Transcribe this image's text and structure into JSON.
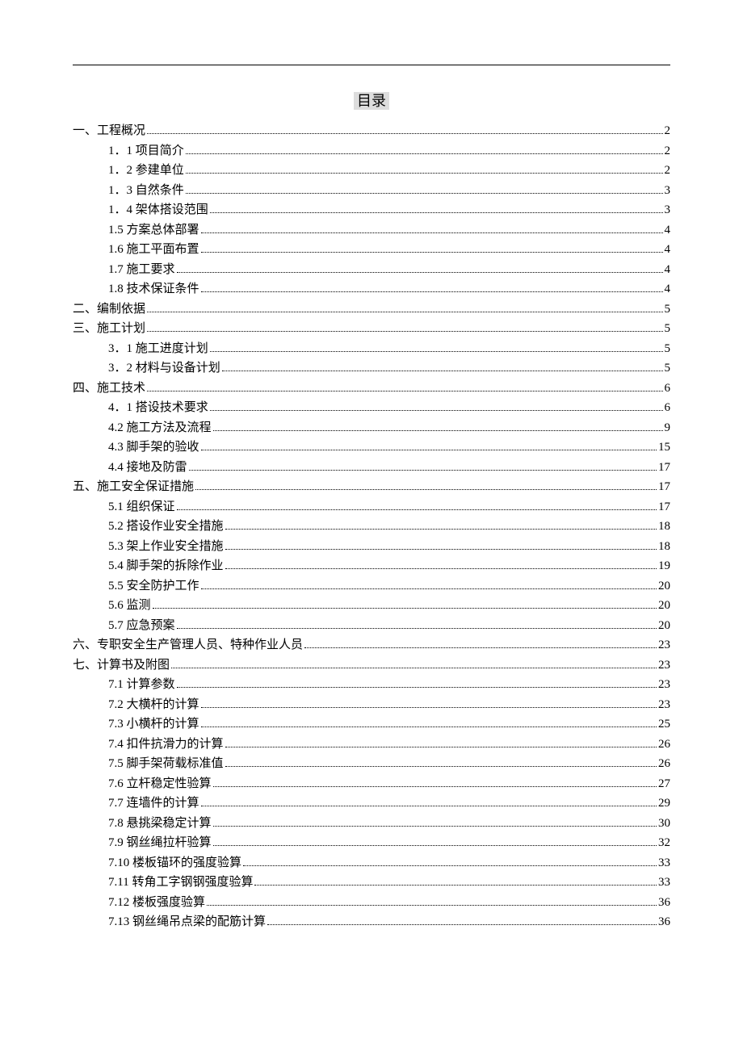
{
  "title": "目录",
  "entries": [
    {
      "level": 1,
      "label": "一、工程概况",
      "page": "2"
    },
    {
      "level": 2,
      "label": "1．1 项目简介",
      "page": "2"
    },
    {
      "level": 2,
      "label": "1．2 参建单位",
      "page": "2"
    },
    {
      "level": 2,
      "label": "1．3 自然条件",
      "page": "3"
    },
    {
      "level": 2,
      "label": "1．4 架体搭设范围",
      "page": "3"
    },
    {
      "level": 2,
      "label": "1.5 方案总体部署",
      "page": "4"
    },
    {
      "level": 2,
      "label": "1.6 施工平面布置",
      "page": "4"
    },
    {
      "level": 2,
      "label": "1.7 施工要求",
      "page": "4"
    },
    {
      "level": 2,
      "label": "1.8 技术保证条件",
      "page": "4"
    },
    {
      "level": 1,
      "label": "二、编制依据",
      "page": "5"
    },
    {
      "level": 1,
      "label": "三、施工计划",
      "page": "5"
    },
    {
      "level": 2,
      "label": "3．1 施工进度计划",
      "page": "5"
    },
    {
      "level": 2,
      "label": "3．2 材料与设备计划",
      "page": "5"
    },
    {
      "level": 1,
      "label": "四、施工技术",
      "page": "6"
    },
    {
      "level": 2,
      "label": "4．1 搭设技术要求",
      "page": "6"
    },
    {
      "level": 2,
      "label": "4.2 施工方法及流程",
      "page": "9"
    },
    {
      "level": 2,
      "label": "4.3 脚手架的验收",
      "page": "15"
    },
    {
      "level": 2,
      "label": "4.4 接地及防雷",
      "page": "17"
    },
    {
      "level": 1,
      "label": "五、施工安全保证措施",
      "page": "17"
    },
    {
      "level": 2,
      "label": "5.1 组织保证",
      "page": "17"
    },
    {
      "level": 2,
      "label": "5.2 搭设作业安全措施",
      "page": "18"
    },
    {
      "level": 2,
      "label": "5.3 架上作业安全措施",
      "page": "18"
    },
    {
      "level": 2,
      "label": "5.4 脚手架的拆除作业",
      "page": "19"
    },
    {
      "level": 2,
      "label": "5.5 安全防护工作",
      "page": "20"
    },
    {
      "level": 2,
      "label": "5.6 监测",
      "page": "20"
    },
    {
      "level": 2,
      "label": "5.7 应急预案",
      "page": "20"
    },
    {
      "level": 1,
      "label": "六、专职安全生产管理人员、特种作业人员",
      "page": "23"
    },
    {
      "level": 1,
      "label": "七、计算书及附图",
      "page": "23"
    },
    {
      "level": 2,
      "label": "7.1 计算参数",
      "page": "23"
    },
    {
      "level": 2,
      "label": "7.2 大横杆的计算",
      "page": "23"
    },
    {
      "level": 2,
      "label": "7.3 小横杆的计算",
      "page": "25"
    },
    {
      "level": 2,
      "label": "7.4 扣件抗滑力的计算",
      "page": "26"
    },
    {
      "level": 2,
      "label": "7.5 脚手架荷载标准值",
      "page": "26"
    },
    {
      "level": 2,
      "label": "7.6 立杆稳定性验算",
      "page": "27"
    },
    {
      "level": 2,
      "label": "7.7 连墙件的计算",
      "page": "29"
    },
    {
      "level": 2,
      "label": "7.8 悬挑梁稳定计算",
      "page": "30"
    },
    {
      "level": 2,
      "label": "7.9 钢丝绳拉杆验算",
      "page": "32"
    },
    {
      "level": 2,
      "label": "7.10 楼板锚环的强度验算",
      "page": "33"
    },
    {
      "level": 2,
      "label": "7.11 转角工字钢钢强度验算",
      "page": "33"
    },
    {
      "level": 2,
      "label": "7.12 楼板强度验算",
      "page": "36"
    },
    {
      "level": 2,
      "label": "7.13 钢丝绳吊点梁的配筋计算",
      "page": "36"
    }
  ]
}
